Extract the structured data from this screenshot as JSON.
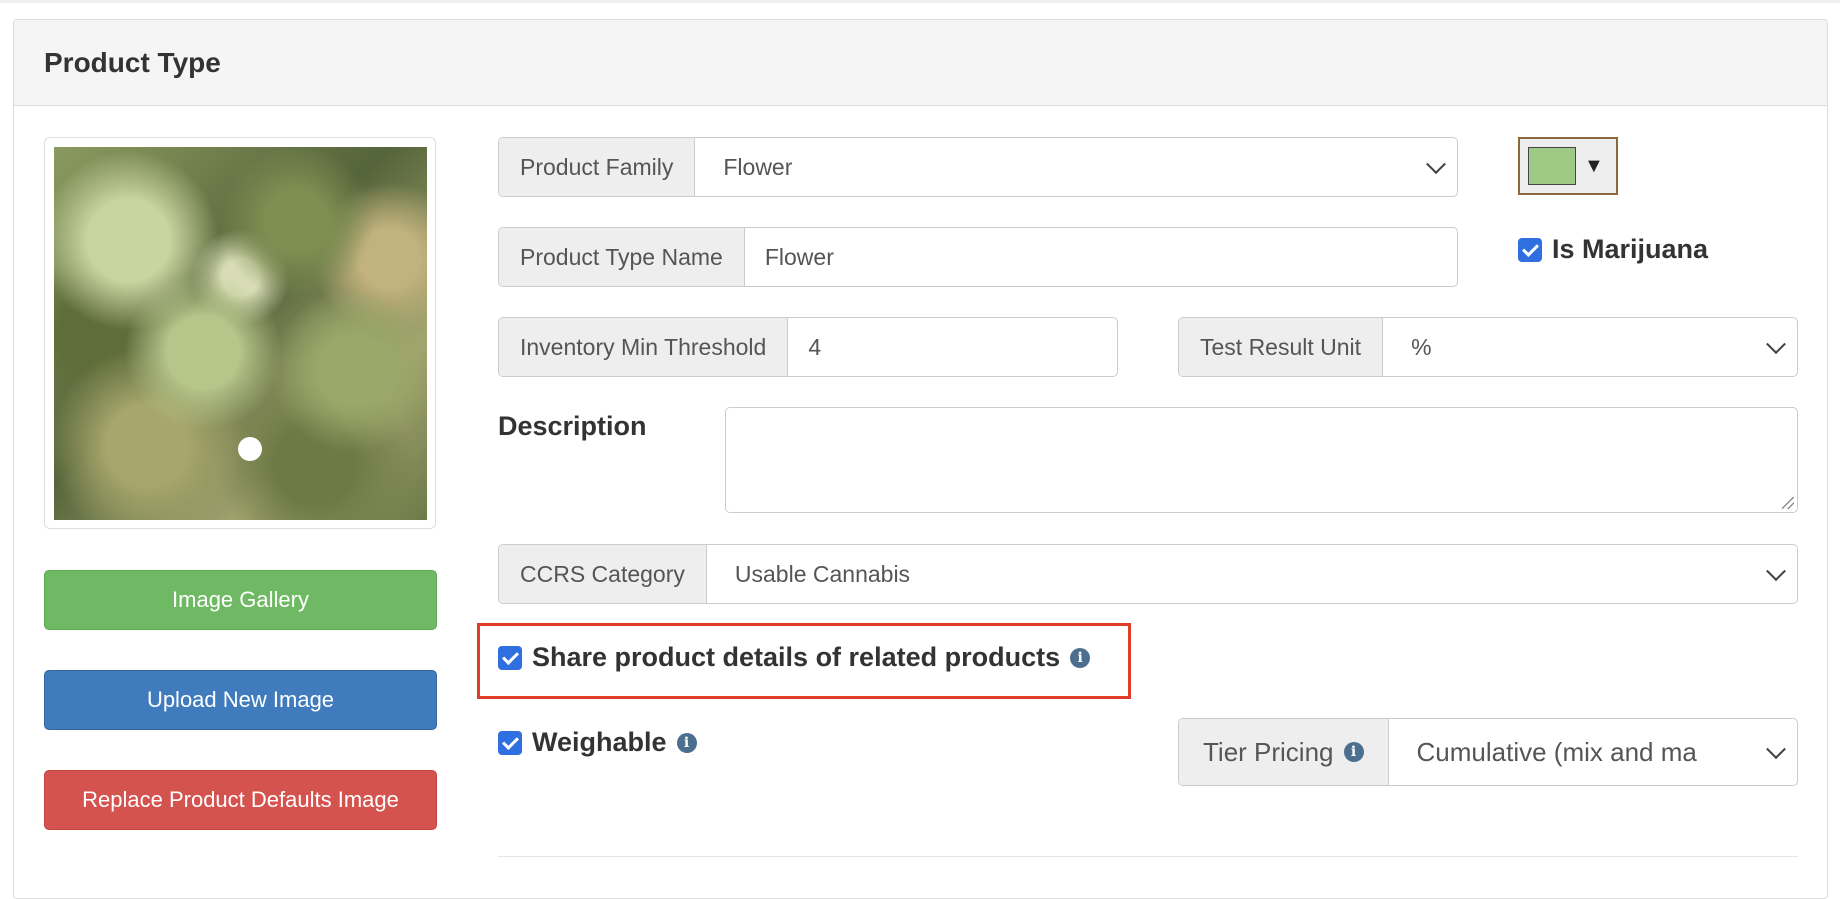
{
  "panel": {
    "title": "Product Type"
  },
  "image_buttons": {
    "gallery": "Image Gallery",
    "upload": "Upload New Image",
    "replace": "Replace Product Defaults Image"
  },
  "form": {
    "product_family": {
      "label": "Product Family",
      "value": "Flower"
    },
    "product_type_name": {
      "label": "Product Type Name",
      "value": "Flower"
    },
    "inventory_min_threshold": {
      "label": "Inventory Min Threshold",
      "value": "4"
    },
    "test_result_unit": {
      "label": "Test Result Unit",
      "value": "%"
    },
    "description": {
      "label": "Description",
      "value": ""
    },
    "ccrs_category": {
      "label": "CCRS Category",
      "value": "Usable Cannabis"
    },
    "is_marijuana": {
      "label": "Is Marijuana",
      "checked": true
    },
    "share_details": {
      "label": "Share product details of related products",
      "checked": true
    },
    "weighable": {
      "label": "Weighable",
      "checked": true
    },
    "tier_pricing": {
      "label": "Tier Pricing",
      "value": "Cumulative (mix and ma"
    },
    "color": {
      "value": "#9fca86",
      "arrow": "▼"
    }
  },
  "colors": {
    "green_button": "#6fb964",
    "blue_button": "#3f7bbd",
    "red_button": "#d5534e",
    "highlight": "#e03d2a",
    "checkbox": "#2f6fe0"
  }
}
